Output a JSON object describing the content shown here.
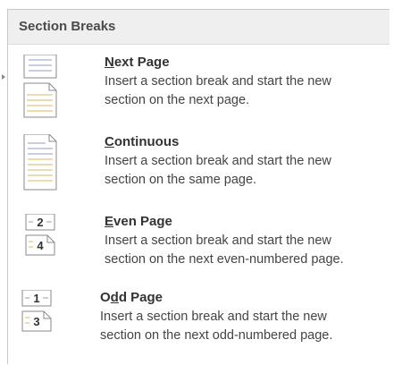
{
  "header": {
    "title": "Section Breaks"
  },
  "items": [
    {
      "id": "next",
      "mnemonic": "N",
      "title_rest": "ext Page",
      "desc_line1": "Insert a section break and start the new",
      "desc_line2": "section on the next page.",
      "icon": "next-page-break-icon"
    },
    {
      "id": "continuous",
      "mnemonic": "C",
      "title_rest": "ontinuous",
      "desc_line1": "Insert a section break and start the new",
      "desc_line2": "section on the same page.",
      "icon": "continuous-break-icon"
    },
    {
      "id": "even",
      "mnemonic": "E",
      "title_rest": "ven Page",
      "desc_line1": "Insert a section break and start the new",
      "desc_line2": "section on the next even-numbered page.",
      "icon": "even-page-break-icon",
      "page_numbers": [
        "2",
        "4"
      ]
    },
    {
      "id": "odd",
      "title_pre": "O",
      "mnemonic": "d",
      "title_rest": "d Page",
      "desc_line1": "Insert a section break and start the new",
      "desc_line2": "section on the next odd-numbered page.",
      "icon": "odd-page-break-icon",
      "page_numbers": [
        "1",
        "3"
      ]
    }
  ]
}
